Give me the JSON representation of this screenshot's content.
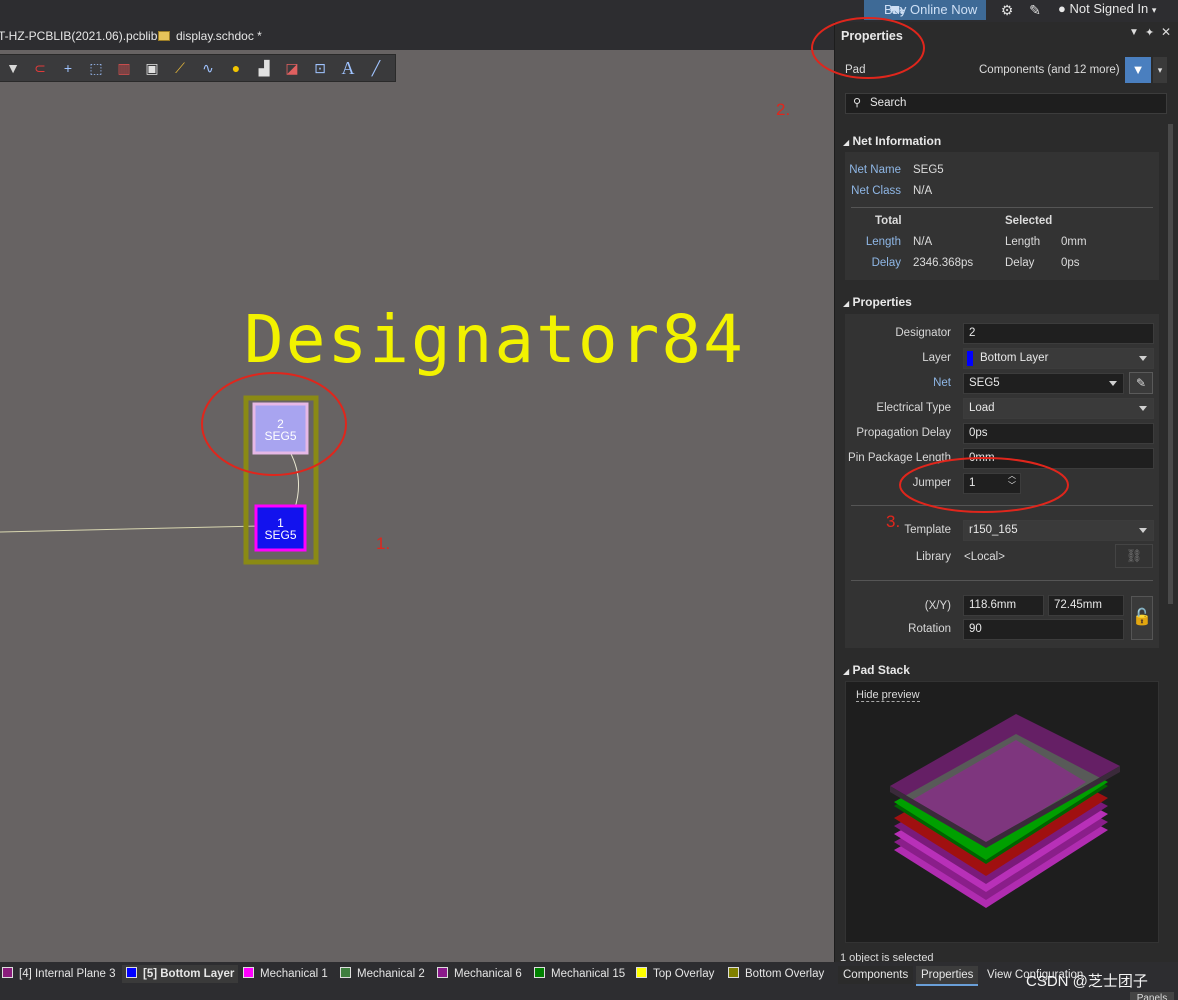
{
  "topbar": {
    "buy_label": "Buy Online Now",
    "user_label": "Not Signed In"
  },
  "tabs": [
    {
      "label": "T-HZ-PCBLIB(2021.06).pcblib *"
    },
    {
      "label": "display.schdoc *"
    }
  ],
  "canvas": {
    "designator_text": "Designator84",
    "pad2": {
      "number": "2",
      "net": "SEG5"
    },
    "pad1": {
      "number": "1",
      "net": "SEG5"
    }
  },
  "annotations": {
    "a1": "1.",
    "a2": "2.",
    "a3": "3."
  },
  "panel": {
    "title": "Properties",
    "object_type": "Pad",
    "filter_label": "Components (and 12 more)",
    "search_placeholder": "Search",
    "net_info": {
      "header": "Net Information",
      "net_name_label": "Net Name",
      "net_name": "SEG5",
      "net_class_label": "Net Class",
      "net_class": "N/A",
      "total_header": "Total",
      "selected_header": "Selected",
      "length_label": "Length",
      "total_length": "N/A",
      "selected_length": "0mm",
      "delay_label": "Delay",
      "total_delay": "2346.368ps",
      "selected_delay": "0ps"
    },
    "properties": {
      "header": "Properties",
      "designator_label": "Designator",
      "designator": "2",
      "layer_label": "Layer",
      "layer": "Bottom Layer",
      "layer_color": "#0000ff",
      "net_label": "Net",
      "net": "SEG5",
      "electrical_type_label": "Electrical Type",
      "electrical_type": "Load",
      "propagation_delay_label": "Propagation Delay",
      "propagation_delay": "0ps",
      "pin_package_length_label": "Pin Package Length",
      "pin_package_length": "0mm",
      "jumper_label": "Jumper",
      "jumper": "1",
      "template_label": "Template",
      "template": "r150_165",
      "library_label": "Library",
      "library": "<Local>",
      "xy_label": "(X/Y)",
      "x": "118.6mm",
      "y": "72.45mm",
      "rotation_label": "Rotation",
      "rotation": "90"
    },
    "pad_stack": {
      "header": "Pad Stack",
      "hide_preview": "Hide preview"
    },
    "status": "1 object is selected",
    "bottom_tabs": [
      "Components",
      "Properties",
      "View Configuration"
    ]
  },
  "layers": [
    {
      "label": "[4] Internal Plane 3",
      "color": "#8a1c7c"
    },
    {
      "label": "[5] Bottom Layer",
      "color": "#0000ff"
    },
    {
      "label": "Mechanical 1",
      "color": "#ff00ff"
    },
    {
      "label": "Mechanical 2",
      "color": "#3f7f3f"
    },
    {
      "label": "Mechanical 6",
      "color": "#8b1a8b"
    },
    {
      "label": "Mechanical 15",
      "color": "#008000"
    },
    {
      "label": "Top Overlay",
      "color": "#ffff00"
    },
    {
      "label": "Bottom Overlay",
      "color": "#808000"
    }
  ],
  "watermark": "CSDN @芝士团子",
  "panels_button": "Panels"
}
